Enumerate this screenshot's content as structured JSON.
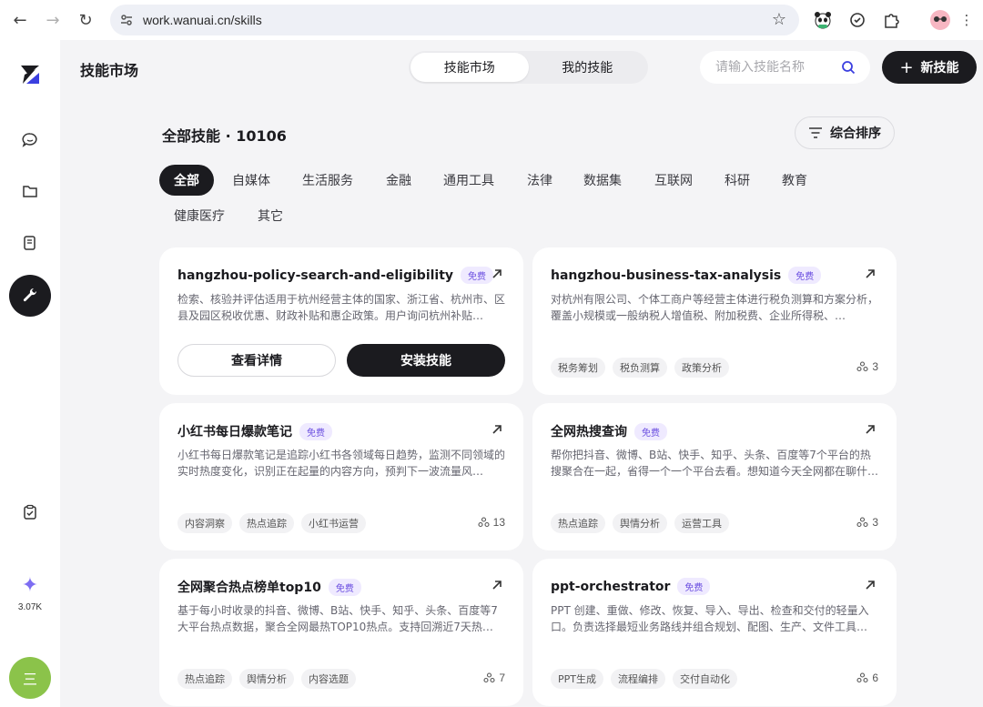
{
  "browser": {
    "url": "work.wanuai.cn/skills"
  },
  "sidebar": {
    "credits": "3.07K",
    "avatar_glyph": "三"
  },
  "header": {
    "title": "技能市场",
    "tabs": [
      {
        "label": "技能市场",
        "active": true
      },
      {
        "label": "我的技能",
        "active": false
      }
    ],
    "search_placeholder": "请输入技能名称",
    "new_button": "新技能"
  },
  "section": {
    "title": "全部技能 · 10106",
    "sort_label": "综合排序"
  },
  "categories": [
    {
      "label": "全部",
      "active": true
    },
    {
      "label": "自媒体"
    },
    {
      "label": "生活服务"
    },
    {
      "label": "金融"
    },
    {
      "label": "通用工具"
    },
    {
      "label": "法律"
    },
    {
      "label": "数据集"
    },
    {
      "label": "互联网"
    },
    {
      "label": "科研"
    },
    {
      "label": "教育"
    },
    {
      "label": "健康医疗"
    },
    {
      "label": "其它"
    }
  ],
  "cards": [
    {
      "name": "hangzhou-policy-search-and-eligibility",
      "badge": "免费",
      "desc": "检索、核验并评估适用于杭州经营主体的国家、浙江省、杭州市、区县及园区税收优惠、财政补贴和惠企政策。用户询问杭州补贴…",
      "hover": true,
      "details_label": "查看详情",
      "install_label": "安装技能"
    },
    {
      "name": "hangzhou-business-tax-analysis",
      "badge": "免费",
      "desc": "对杭州有限公司、个体工商户等经营主体进行税负测算和方案分析，覆盖小规模或一般纳税人增值税、附加税费、企业所得税、…",
      "tags": [
        "税务筹划",
        "税负测算",
        "政策分析"
      ],
      "users": "3"
    },
    {
      "name": "小红书每日爆款笔记",
      "badge": "免费",
      "desc": "小红书每日爆款笔记是追踪小红书各领域每日趋势，监测不同领域的实时热度变化，识别正在起量的内容方向，预判下一波流量风…",
      "tags": [
        "内容洞察",
        "热点追踪",
        "小红书运营"
      ],
      "users": "13"
    },
    {
      "name": "全网热搜查询",
      "badge": "免费",
      "desc": "帮你把抖音、微博、B站、快手、知乎、头条、百度等7个平台的热搜聚合在一起，省得一个一个平台去看。想知道今天全网都在聊什…",
      "tags": [
        "热点追踪",
        "舆情分析",
        "运营工具"
      ],
      "users": "3"
    },
    {
      "name": "全网聚合热点榜单top10",
      "badge": "免费",
      "desc": "基于每小时收录的抖音、微博、B站、快手、知乎、头条、百度等7大平台热点数据，聚合全网最热TOP10热点。支持回溯近7天热…",
      "tags": [
        "热点追踪",
        "舆情分析",
        "内容选题"
      ],
      "users": "7"
    },
    {
      "name": "ppt-orchestrator",
      "badge": "免费",
      "desc": "PPT 创建、重做、修改、恢复、导入、导出、检查和交付的轻量入口。负责选择最短业务路线并组合规划、配图、生产、文件工具…",
      "tags": [
        "PPT生成",
        "流程编排",
        "交付自动化"
      ],
      "users": "6"
    }
  ]
}
